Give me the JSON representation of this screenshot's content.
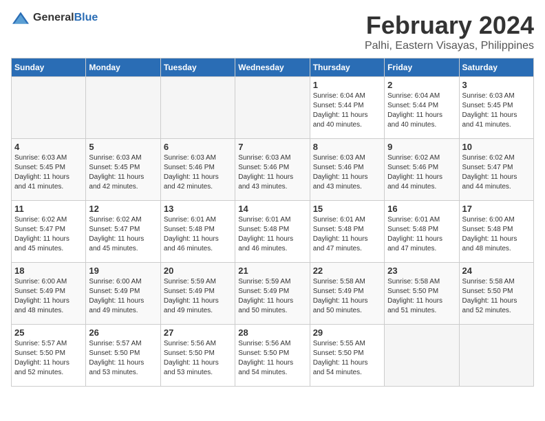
{
  "logo": {
    "general": "General",
    "blue": "Blue"
  },
  "title": "February 2024",
  "subtitle": "Palhi, Eastern Visayas, Philippines",
  "headers": [
    "Sunday",
    "Monday",
    "Tuesday",
    "Wednesday",
    "Thursday",
    "Friday",
    "Saturday"
  ],
  "weeks": [
    [
      {
        "day": "",
        "info": ""
      },
      {
        "day": "",
        "info": ""
      },
      {
        "day": "",
        "info": ""
      },
      {
        "day": "",
        "info": ""
      },
      {
        "day": "1",
        "info": "Sunrise: 6:04 AM\nSunset: 5:44 PM\nDaylight: 11 hours\nand 40 minutes."
      },
      {
        "day": "2",
        "info": "Sunrise: 6:04 AM\nSunset: 5:44 PM\nDaylight: 11 hours\nand 40 minutes."
      },
      {
        "day": "3",
        "info": "Sunrise: 6:03 AM\nSunset: 5:45 PM\nDaylight: 11 hours\nand 41 minutes."
      }
    ],
    [
      {
        "day": "4",
        "info": "Sunrise: 6:03 AM\nSunset: 5:45 PM\nDaylight: 11 hours\nand 41 minutes."
      },
      {
        "day": "5",
        "info": "Sunrise: 6:03 AM\nSunset: 5:45 PM\nDaylight: 11 hours\nand 42 minutes."
      },
      {
        "day": "6",
        "info": "Sunrise: 6:03 AM\nSunset: 5:46 PM\nDaylight: 11 hours\nand 42 minutes."
      },
      {
        "day": "7",
        "info": "Sunrise: 6:03 AM\nSunset: 5:46 PM\nDaylight: 11 hours\nand 43 minutes."
      },
      {
        "day": "8",
        "info": "Sunrise: 6:03 AM\nSunset: 5:46 PM\nDaylight: 11 hours\nand 43 minutes."
      },
      {
        "day": "9",
        "info": "Sunrise: 6:02 AM\nSunset: 5:46 PM\nDaylight: 11 hours\nand 44 minutes."
      },
      {
        "day": "10",
        "info": "Sunrise: 6:02 AM\nSunset: 5:47 PM\nDaylight: 11 hours\nand 44 minutes."
      }
    ],
    [
      {
        "day": "11",
        "info": "Sunrise: 6:02 AM\nSunset: 5:47 PM\nDaylight: 11 hours\nand 45 minutes."
      },
      {
        "day": "12",
        "info": "Sunrise: 6:02 AM\nSunset: 5:47 PM\nDaylight: 11 hours\nand 45 minutes."
      },
      {
        "day": "13",
        "info": "Sunrise: 6:01 AM\nSunset: 5:48 PM\nDaylight: 11 hours\nand 46 minutes."
      },
      {
        "day": "14",
        "info": "Sunrise: 6:01 AM\nSunset: 5:48 PM\nDaylight: 11 hours\nand 46 minutes."
      },
      {
        "day": "15",
        "info": "Sunrise: 6:01 AM\nSunset: 5:48 PM\nDaylight: 11 hours\nand 47 minutes."
      },
      {
        "day": "16",
        "info": "Sunrise: 6:01 AM\nSunset: 5:48 PM\nDaylight: 11 hours\nand 47 minutes."
      },
      {
        "day": "17",
        "info": "Sunrise: 6:00 AM\nSunset: 5:48 PM\nDaylight: 11 hours\nand 48 minutes."
      }
    ],
    [
      {
        "day": "18",
        "info": "Sunrise: 6:00 AM\nSunset: 5:49 PM\nDaylight: 11 hours\nand 48 minutes."
      },
      {
        "day": "19",
        "info": "Sunrise: 6:00 AM\nSunset: 5:49 PM\nDaylight: 11 hours\nand 49 minutes."
      },
      {
        "day": "20",
        "info": "Sunrise: 5:59 AM\nSunset: 5:49 PM\nDaylight: 11 hours\nand 49 minutes."
      },
      {
        "day": "21",
        "info": "Sunrise: 5:59 AM\nSunset: 5:49 PM\nDaylight: 11 hours\nand 50 minutes."
      },
      {
        "day": "22",
        "info": "Sunrise: 5:58 AM\nSunset: 5:49 PM\nDaylight: 11 hours\nand 50 minutes."
      },
      {
        "day": "23",
        "info": "Sunrise: 5:58 AM\nSunset: 5:50 PM\nDaylight: 11 hours\nand 51 minutes."
      },
      {
        "day": "24",
        "info": "Sunrise: 5:58 AM\nSunset: 5:50 PM\nDaylight: 11 hours\nand 52 minutes."
      }
    ],
    [
      {
        "day": "25",
        "info": "Sunrise: 5:57 AM\nSunset: 5:50 PM\nDaylight: 11 hours\nand 52 minutes."
      },
      {
        "day": "26",
        "info": "Sunrise: 5:57 AM\nSunset: 5:50 PM\nDaylight: 11 hours\nand 53 minutes."
      },
      {
        "day": "27",
        "info": "Sunrise: 5:56 AM\nSunset: 5:50 PM\nDaylight: 11 hours\nand 53 minutes."
      },
      {
        "day": "28",
        "info": "Sunrise: 5:56 AM\nSunset: 5:50 PM\nDaylight: 11 hours\nand 54 minutes."
      },
      {
        "day": "29",
        "info": "Sunrise: 5:55 AM\nSunset: 5:50 PM\nDaylight: 11 hours\nand 54 minutes."
      },
      {
        "day": "",
        "info": ""
      },
      {
        "day": "",
        "info": ""
      }
    ]
  ]
}
